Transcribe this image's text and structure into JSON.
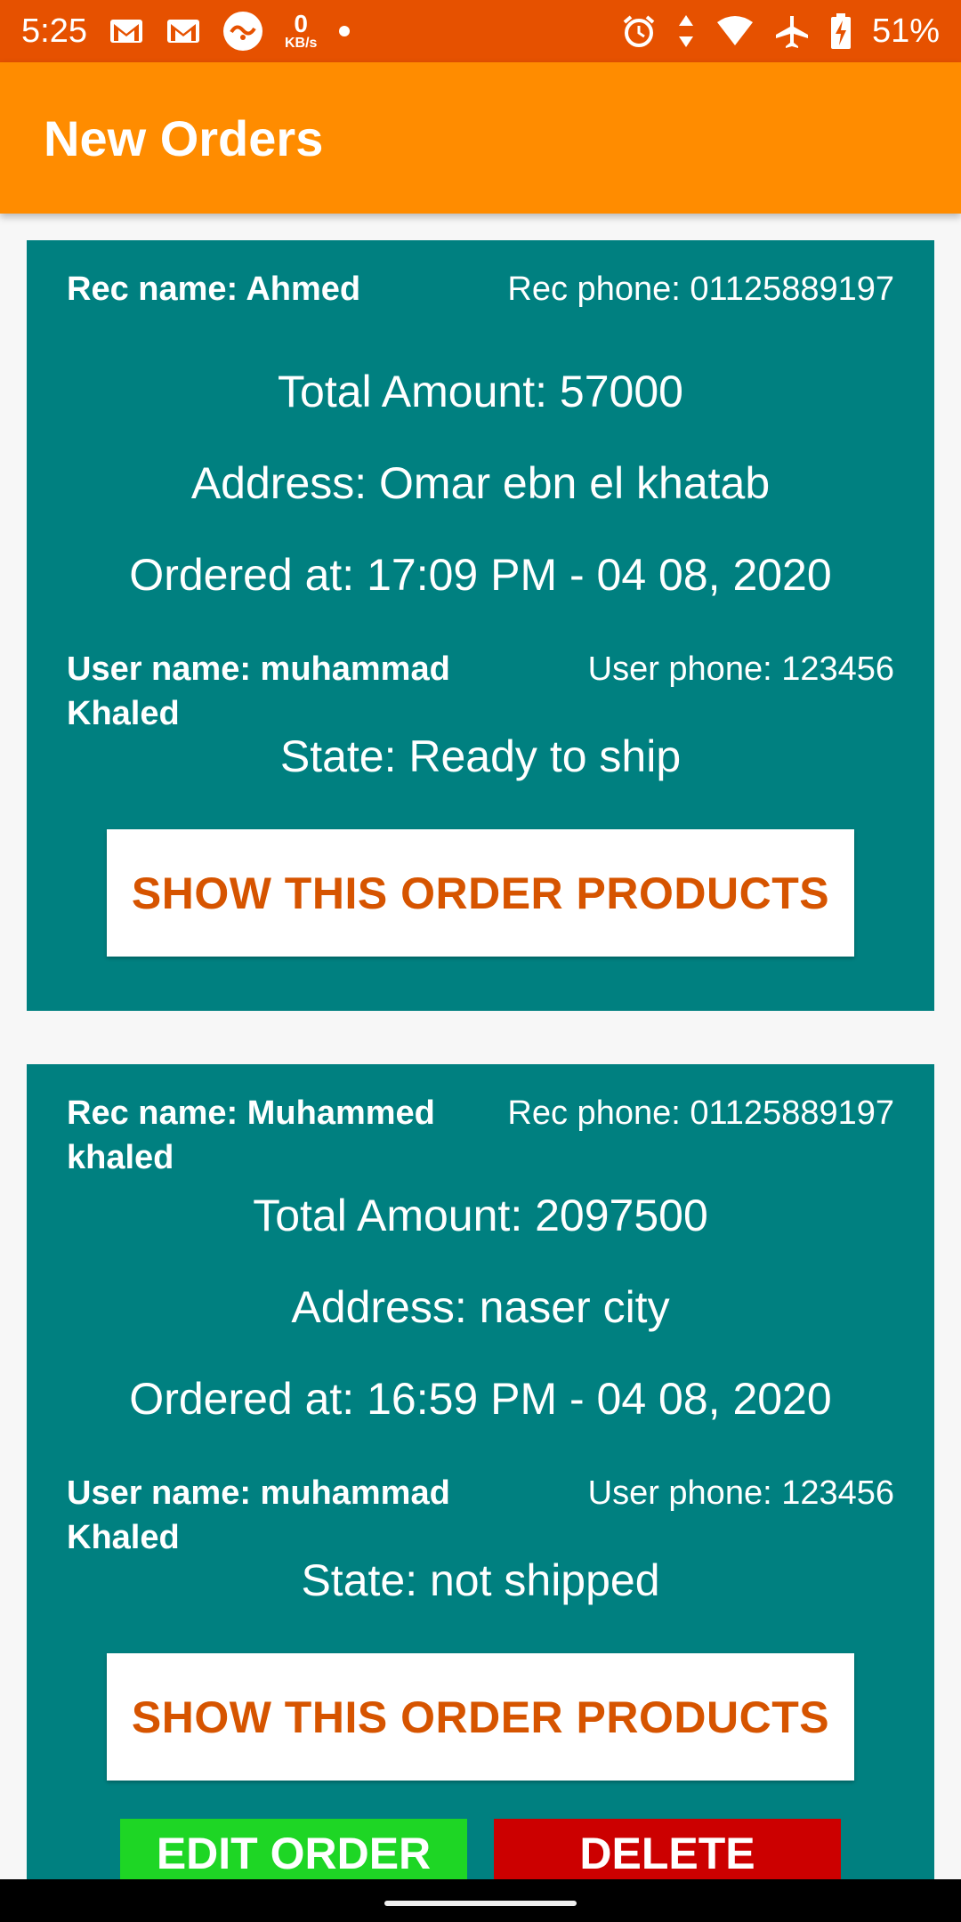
{
  "status_bar": {
    "time": "5:25",
    "net_speed_value": "0",
    "net_speed_unit": "KB/s",
    "battery": "51%",
    "icons": [
      "gmail-icon",
      "gmail-icon",
      "app-notification-icon",
      "dot-icon",
      "alarm-icon",
      "data-icon",
      "wifi-icon",
      "airplane-icon",
      "battery-charging-icon"
    ]
  },
  "app_bar": {
    "title": "New Orders"
  },
  "colors": {
    "status_bar": "#e65100",
    "app_bar": "#ff8c00",
    "card": "#008080",
    "button_text": "#d65400",
    "edit_button": "#1ed625",
    "delete_button": "#cc0000"
  },
  "orders": [
    {
      "rec_name": "Rec name: Ahmed",
      "rec_phone": "Rec phone: 01125889197",
      "total": "Total Amount: 57000",
      "address": "Address: Omar ebn el khatab",
      "ordered_at": "Ordered at: 17:09 PM - 04 08, 2020",
      "user_name": "User name: muhammad Khaled",
      "user_phone": "User phone: 123456",
      "state": "State: Ready to ship",
      "products_button": "SHOW THIS ORDER PRODUCTS"
    },
    {
      "rec_name": "Rec name: Muhammed khaled",
      "rec_phone": "Rec phone: 01125889197",
      "total": "Total Amount: 2097500",
      "address": "Address: naser city",
      "ordered_at": "Ordered at: 16:59 PM - 04 08, 2020",
      "user_name": "User name: muhammad Khaled",
      "user_phone": "User phone: 123456",
      "state": "State: not shipped",
      "products_button": "SHOW THIS ORDER PRODUCTS",
      "edit_button": "EDIT ORDER",
      "delete_button": "DELETE"
    }
  ]
}
